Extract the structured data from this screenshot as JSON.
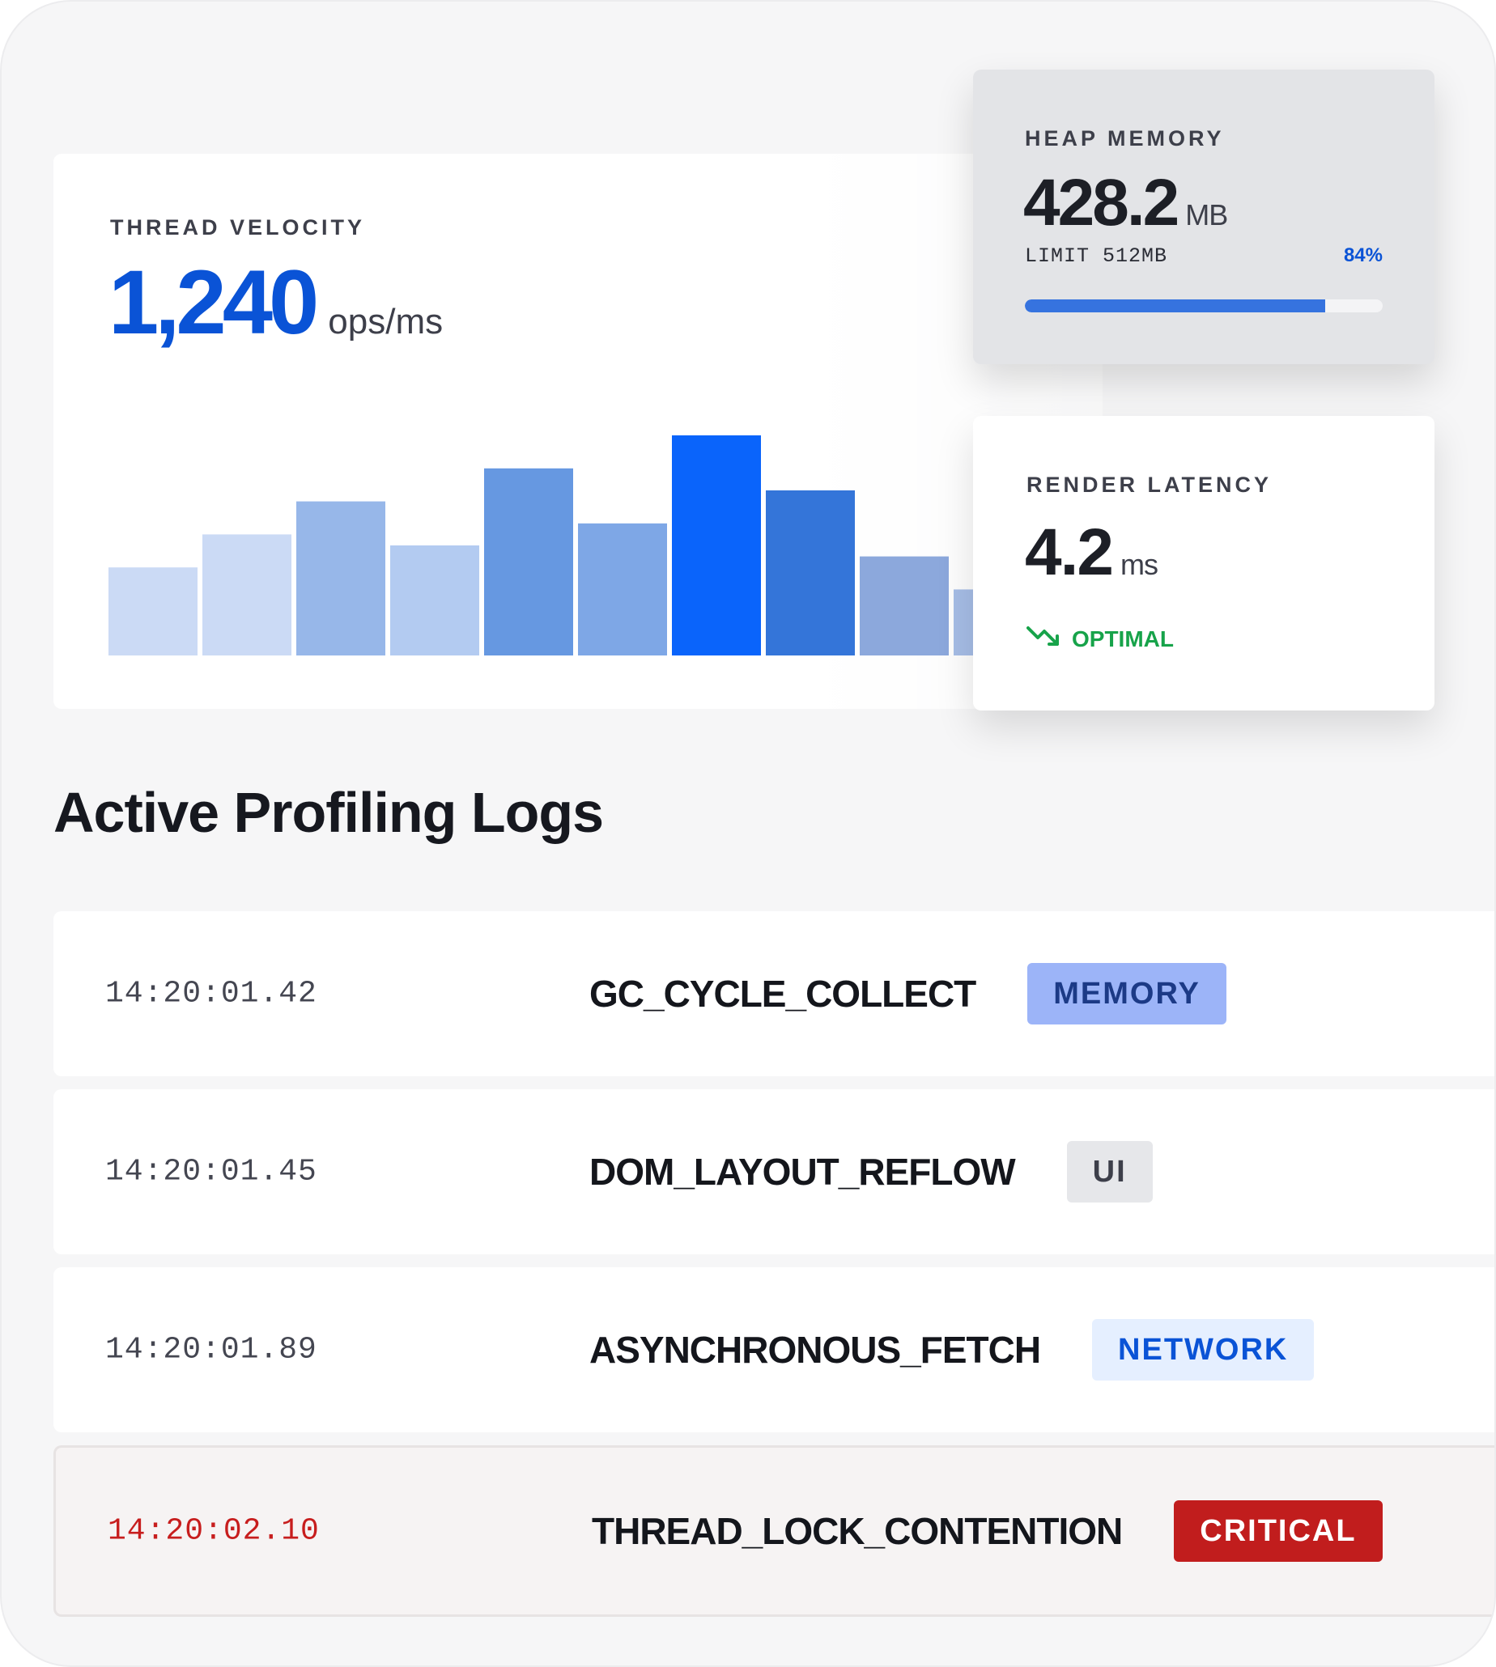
{
  "thread_velocity": {
    "label": "THREAD VELOCITY",
    "value": "1,240",
    "unit": "ops/ms",
    "bars": [
      0.4,
      0.55,
      0.7,
      0.5,
      0.85,
      0.6,
      1.0,
      0.75,
      0.45,
      0.3
    ],
    "bar_colors": [
      "#cbdaf5",
      "#cbdaf5",
      "#97b7e9",
      "#b3cbf1",
      "#6698e1",
      "#7ea7e6",
      "#0a64fb",
      "#3475d9",
      "#8ca8dc",
      "#a6bde6"
    ]
  },
  "heap_memory": {
    "label": "HEAP MEMORY",
    "value": "428.2",
    "unit": "MB",
    "limit": "LIMIT 512MB",
    "percent_label": "84%",
    "fill_fraction": 0.84
  },
  "render_latency": {
    "label": "RENDER LATENCY",
    "value": "4.2",
    "unit": "ms",
    "status": "OPTIMAL",
    "status_color": "#17a34a"
  },
  "logs": {
    "title": "Active Profiling Logs",
    "rows": [
      {
        "time": "14:20:01.42",
        "event": "GC_CYCLE_COLLECT",
        "tag": "MEMORY"
      },
      {
        "time": "14:20:01.45",
        "event": "DOM_LAYOUT_REFLOW",
        "tag": "UI"
      },
      {
        "time": "14:20:01.89",
        "event": "ASYNCHRONOUS_FETCH",
        "tag": "NETWORK"
      },
      {
        "time": "14:20:02.10",
        "event": "THREAD_LOCK_CONTENTION",
        "tag": "CRITICAL"
      }
    ]
  },
  "colors": {
    "accent": "#0a53d6",
    "critical": "#c11d1d"
  }
}
